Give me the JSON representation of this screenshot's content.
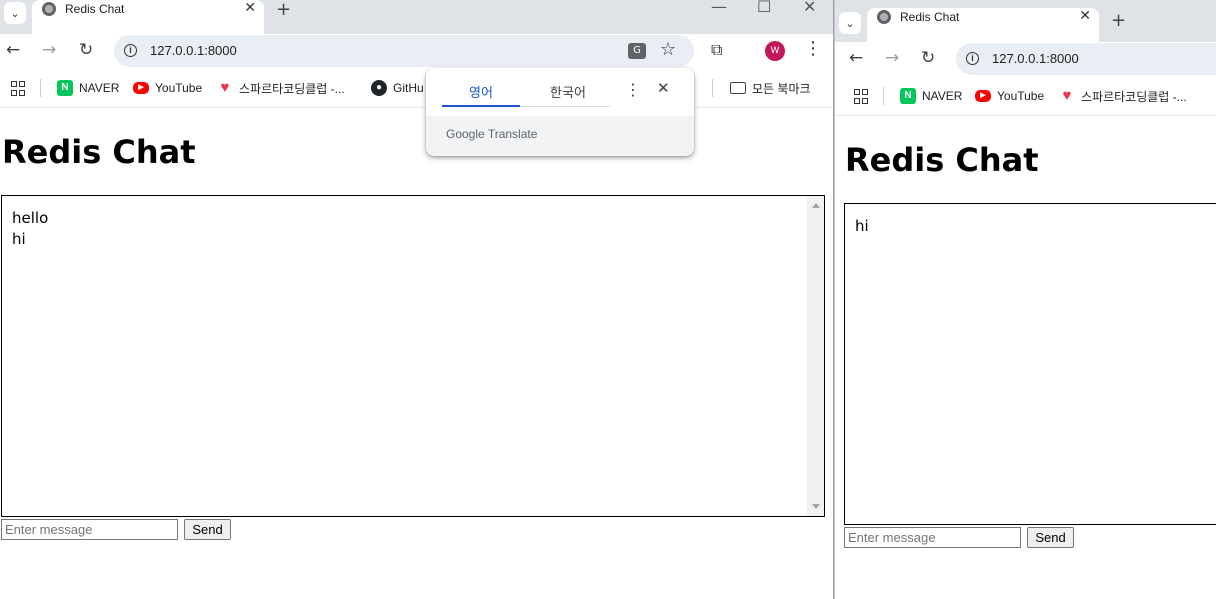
{
  "left_window": {
    "tab_title": "Redis Chat",
    "url": "127.0.0.1:8000",
    "avatar_letter": "W",
    "bookmarks": [
      {
        "label": "NAVER",
        "icon": "naver-icon"
      },
      {
        "label": "YouTube",
        "icon": "youtube-icon"
      },
      {
        "label": "스파르타코딩클럽 -...",
        "icon": "sparta-icon"
      },
      {
        "label": "GitHu",
        "icon": "github-icon"
      }
    ],
    "all_bookmarks_label": "모든 북마크",
    "page_title": "Redis Chat",
    "messages": [
      "hello",
      "hi"
    ],
    "input_placeholder": "Enter message",
    "send_label": "Send",
    "translate_popup": {
      "source_lang": "영어",
      "target_lang": "한국어",
      "footer": "Google Translate"
    }
  },
  "right_window": {
    "tab_title": "Redis Chat",
    "url": "127.0.0.1:8000",
    "bookmarks": [
      {
        "label": "NAVER",
        "icon": "naver-icon"
      },
      {
        "label": "YouTube",
        "icon": "youtube-icon"
      },
      {
        "label": "스파르타코딩클럽 -...",
        "icon": "sparta-icon"
      }
    ],
    "page_title": "Redis Chat",
    "messages": [
      "hi"
    ],
    "input_placeholder": "Enter message",
    "send_label": "Send"
  },
  "colors": {
    "tabstrip": "#dfe3e8",
    "omnibox": "#e9edf4",
    "accent": "#1a56c9",
    "avatar": "#c2185b"
  }
}
